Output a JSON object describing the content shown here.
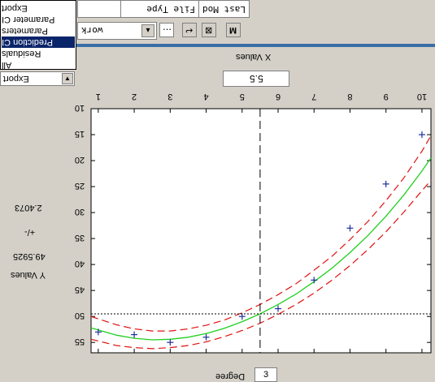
{
  "file_header": {
    "col_type": "File Type",
    "col_modified": "Last Mod"
  },
  "path_field": {
    "value": "work"
  },
  "toolbar": {
    "btn_a": "↩",
    "btn_b": "⊠",
    "btn_c": "M"
  },
  "dropdown": {
    "items": [
      "All",
      "Residuals",
      "Prediction CI",
      "Parameters",
      "Parameter CI",
      "Export"
    ],
    "selected": "Prediction CI"
  },
  "export_select": {
    "value": "Export"
  },
  "x_values": {
    "label": "X Values",
    "value": "5.5"
  },
  "prediction": {
    "y_value": "2.4073",
    "pm": "+/-",
    "ci": "49.5925",
    "y_label": "Y Values"
  },
  "degree": {
    "label": "Degree",
    "value": "3"
  },
  "chart_data": {
    "type": "scatter",
    "title": "",
    "xlabel": "",
    "ylabel": "",
    "xlim": [
      0.8,
      10.25
    ],
    "ylim": [
      10,
      57
    ],
    "x_ticks": [
      1,
      2,
      3,
      4,
      5,
      6,
      7,
      8,
      9,
      10
    ],
    "y_ticks": [
      10,
      15,
      20,
      25,
      30,
      35,
      40,
      45,
      50,
      55
    ],
    "points": [
      {
        "x": 1,
        "y": 53
      },
      {
        "x": 2,
        "y": 53.5
      },
      {
        "x": 3,
        "y": 55
      },
      {
        "x": 4,
        "y": 54
      },
      {
        "x": 5,
        "y": 50
      },
      {
        "x": 6,
        "y": 48.5
      },
      {
        "x": 7,
        "y": 43
      },
      {
        "x": 8,
        "y": 33
      },
      {
        "x": 9,
        "y": 24.5
      },
      {
        "x": 10,
        "y": 15
      }
    ],
    "fit": [
      {
        "x": 0.8,
        "y": 52.2
      },
      {
        "x": 1.5,
        "y": 53.6
      },
      {
        "x": 2,
        "y": 54.2
      },
      {
        "x": 2.5,
        "y": 54.5
      },
      {
        "x": 3,
        "y": 54.4
      },
      {
        "x": 3.5,
        "y": 54.0
      },
      {
        "x": 4,
        "y": 53.3
      },
      {
        "x": 4.5,
        "y": 52.3
      },
      {
        "x": 5,
        "y": 51.0
      },
      {
        "x": 5.5,
        "y": 49.5
      },
      {
        "x": 6,
        "y": 47.7
      },
      {
        "x": 6.5,
        "y": 45.7
      },
      {
        "x": 7,
        "y": 43.3
      },
      {
        "x": 7.5,
        "y": 40.7
      },
      {
        "x": 8,
        "y": 37.7
      },
      {
        "x": 8.5,
        "y": 34.4
      },
      {
        "x": 9,
        "y": 30.7
      },
      {
        "x": 9.5,
        "y": 26.6
      },
      {
        "x": 10,
        "y": 22.0
      },
      {
        "x": 10.25,
        "y": 19.5
      }
    ],
    "ci_halfwidth": [
      2.2,
      2.0,
      1.8,
      1.7,
      1.6,
      1.6,
      1.6,
      1.6,
      1.7,
      1.8,
      1.9,
      2.0,
      2.2,
      2.3,
      2.5,
      2.7,
      3.0,
      3.3,
      3.8,
      4.3
    ],
    "cursor": {
      "x": 5.5,
      "y": 49.5
    },
    "colors": {
      "points": "#1c2f9c",
      "fit": "#20d020",
      "ci": "#e01010",
      "cursor": "#000000"
    }
  }
}
